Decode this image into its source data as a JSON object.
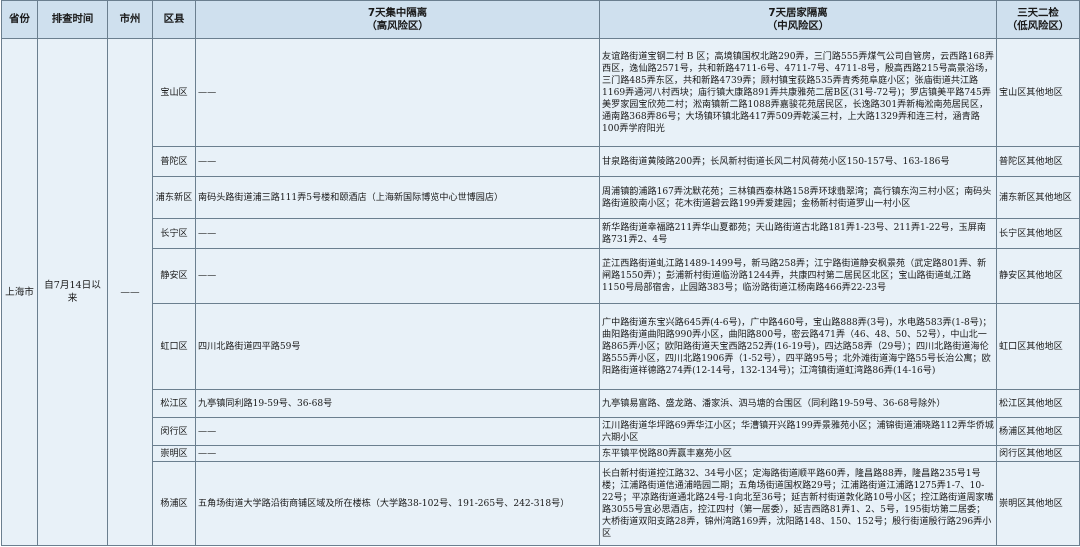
{
  "header": {
    "province": "省份",
    "time": "排查时间",
    "city": "市州",
    "district": "区县",
    "high_title": "7天集中隔离",
    "high_sub": "（高风险区）",
    "mid_title": "7天居家隔离",
    "mid_sub": "（中风险区）",
    "low_title": "三天二检",
    "low_sub": "（低风险区）"
  },
  "merged": {
    "province": "上海市",
    "time": "自7月14日以来",
    "city": "——"
  },
  "rows": [
    {
      "district": "宝山区",
      "high": "——",
      "mid": "友谊路街道宝钢二村 B 区；高境镇国权北路290弄，三门路555弄煤气公司自管房，云西路168弄西区，逸仙路2571号，共和新路4711-6号、4711-7号、4711-8号，殷高西路215号高景浴场，三门路485弄东区，共和新路4739弄；顾村镇宝荻路535弄青秀苑阜庭小区；张庙街道共江路1169弄通河八村西块；庙行镇大康路891弄共康雅苑二居B区(31号-72号)；罗店镇美平路745弄美罗家园宝欣苑二村；淞南镇新二路1088弄嘉骏花苑居民区，长逸路301弄新梅淞南苑居民区，通南路368弄86号；大场镇环镇北路417弄509弄乾溪三村，上大路1329弄和连三村，涵青路100弄学府阳光",
      "low": "宝山区其他地区"
    },
    {
      "district": "普陀区",
      "high": "——",
      "mid": "甘泉路街道黄陵路200弄；长风新村街道长风二村风荷苑小区150-157号、163-186号",
      "low": "普陀区其他地区"
    },
    {
      "district": "浦东新区",
      "high": "南码头路街道浦三路111弄5号楼和颐酒店（上海新国际博览中心世博园店）",
      "mid": "周浦镇韵浦路167弄沈默花苑；三林镇西泰林路158弄环球翡翠湾；高行镇东沟三村小区；南码头路街道胶南小区；花木街道碧云路199弄爱建园；金杨新村街道罗山一村小区",
      "low": "浦东新区其他地区"
    },
    {
      "district": "长宁区",
      "high": "——",
      "mid": "新华路街道幸福路211弄华山夏都苑；天山路街道古北路181弄1-23号、211弄1-22号，玉屏南路731弄2、4号",
      "low": "长宁区其他地区"
    },
    {
      "district": "静安区",
      "high": "——",
      "mid": "芷江西路街道虬江路1489-1499号，新马路258弄；江宁路街道静安枫景苑（武定路801弄、新闸路1550弄）；彭浦新村街道临汾路1244弄，共康四村第二居民区北区；宝山路街道虬江路1150号局部宿舍，止园路383号；临汾路街道江杨南路466弄22-23号",
      "low": "静安区其他地区"
    },
    {
      "district": "虹口区",
      "high": "四川北路街道四平路59号",
      "mid": "广中路街道东宝兴路645弄(4-6号)，广中路460号，宝山路888弄(3号)，水电路583弄(1-8号)；曲阳路街道曲阳路990弄小区，曲阳路800号，密云路471弄（46、48、50、52号），中山北一路865弄小区；欧阳路街道天宝西路252弄(16-19号)，四达路58弄（29号）；四川北路街道海伦路555弄小区，四川北路1906弄（1-52号），四平路95号；北外滩街道海宁路55号长治公寓；欧阳路街道祥德路274弄(12-14号，132-134号)；江湾镇街道虹湾路86弄(14-16号)",
      "low": "虹口区其他地区"
    },
    {
      "district": "松江区",
      "high": "九亭镇同利路19-59号、36-68号",
      "mid": "九亭镇易富路、盛龙路、潘家浜、泗马塘的合围区（同利路19-59号、36-68号除外）",
      "low": "松江区其他地区"
    },
    {
      "district": "闵行区",
      "high": "——",
      "mid": "江川路街道华坪路69弄华江小区；华漕镇开兴路199弄景雅苑小区；浦锦街道浦晓路112弄华侨城六期小区",
      "low": "杨浦区其他地区"
    },
    {
      "district": "崇明区",
      "high": "——",
      "mid": "东平镇平悦路80弄赢丰嘉苑小区",
      "low": "闵行区其他地区"
    },
    {
      "district": "杨浦区",
      "high": "五角场街道大学路沿街商铺区域及所在楼栋（大学路38-102号、191-265号、242-318号）",
      "mid": "长白新村街道控江路32、34号小区；定海路街道顺平路60弄，隆昌路88弄，隆昌路235号1号楼；江浦路街道信通浦皓园二期；五角场街道国权路29号；江浦路街道江浦路1275弄1-7、10-22号；平凉路街道通北路24号-1向北至36号；延吉新村街道敦化路10号小区；控江路街道周家嘴路3055号宜必思酒店，控江四村（第一居委），延吉西路81弄1、2、5号，195街坊第二居委；大桥街道双阳支路28弄，锦州湾路169弄，沈阳路148、150、152号；殷行街道殷行路296弄小区",
      "low": "崇明区其他地区"
    }
  ]
}
